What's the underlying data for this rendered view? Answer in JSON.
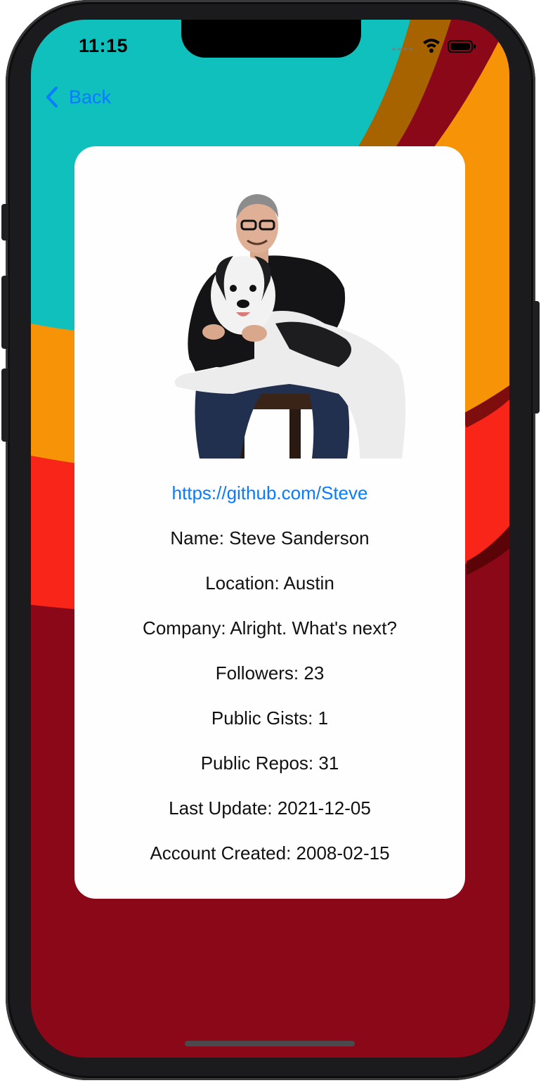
{
  "status_bar": {
    "time": "11:15",
    "icons": [
      "cellular-signal-icon",
      "wifi-icon",
      "battery-icon"
    ]
  },
  "nav": {
    "back_label": "Back",
    "back_icon": "chevron-left-icon"
  },
  "profile": {
    "avatar_icon": "profile-photo",
    "url": "https://github.com/Steve",
    "name": "Name: Steve Sanderson",
    "location": "Location: Austin",
    "company": "Company: Alright. What's next?",
    "followers": "Followers: 23",
    "public_gists": "Public Gists: 1",
    "public_repos": "Public Repos: 31",
    "last_update": "Last Update: 2021-12-05",
    "account_created": "Account Created: 2008-02-15"
  },
  "colors": {
    "accent": "#0a7bff",
    "background_teal": "#0fc0bd",
    "background_orange": "#f79306",
    "background_brown": "#a76300",
    "background_red": "#f82518",
    "background_dark_red": "#8b0818",
    "card": "#fefefe"
  }
}
